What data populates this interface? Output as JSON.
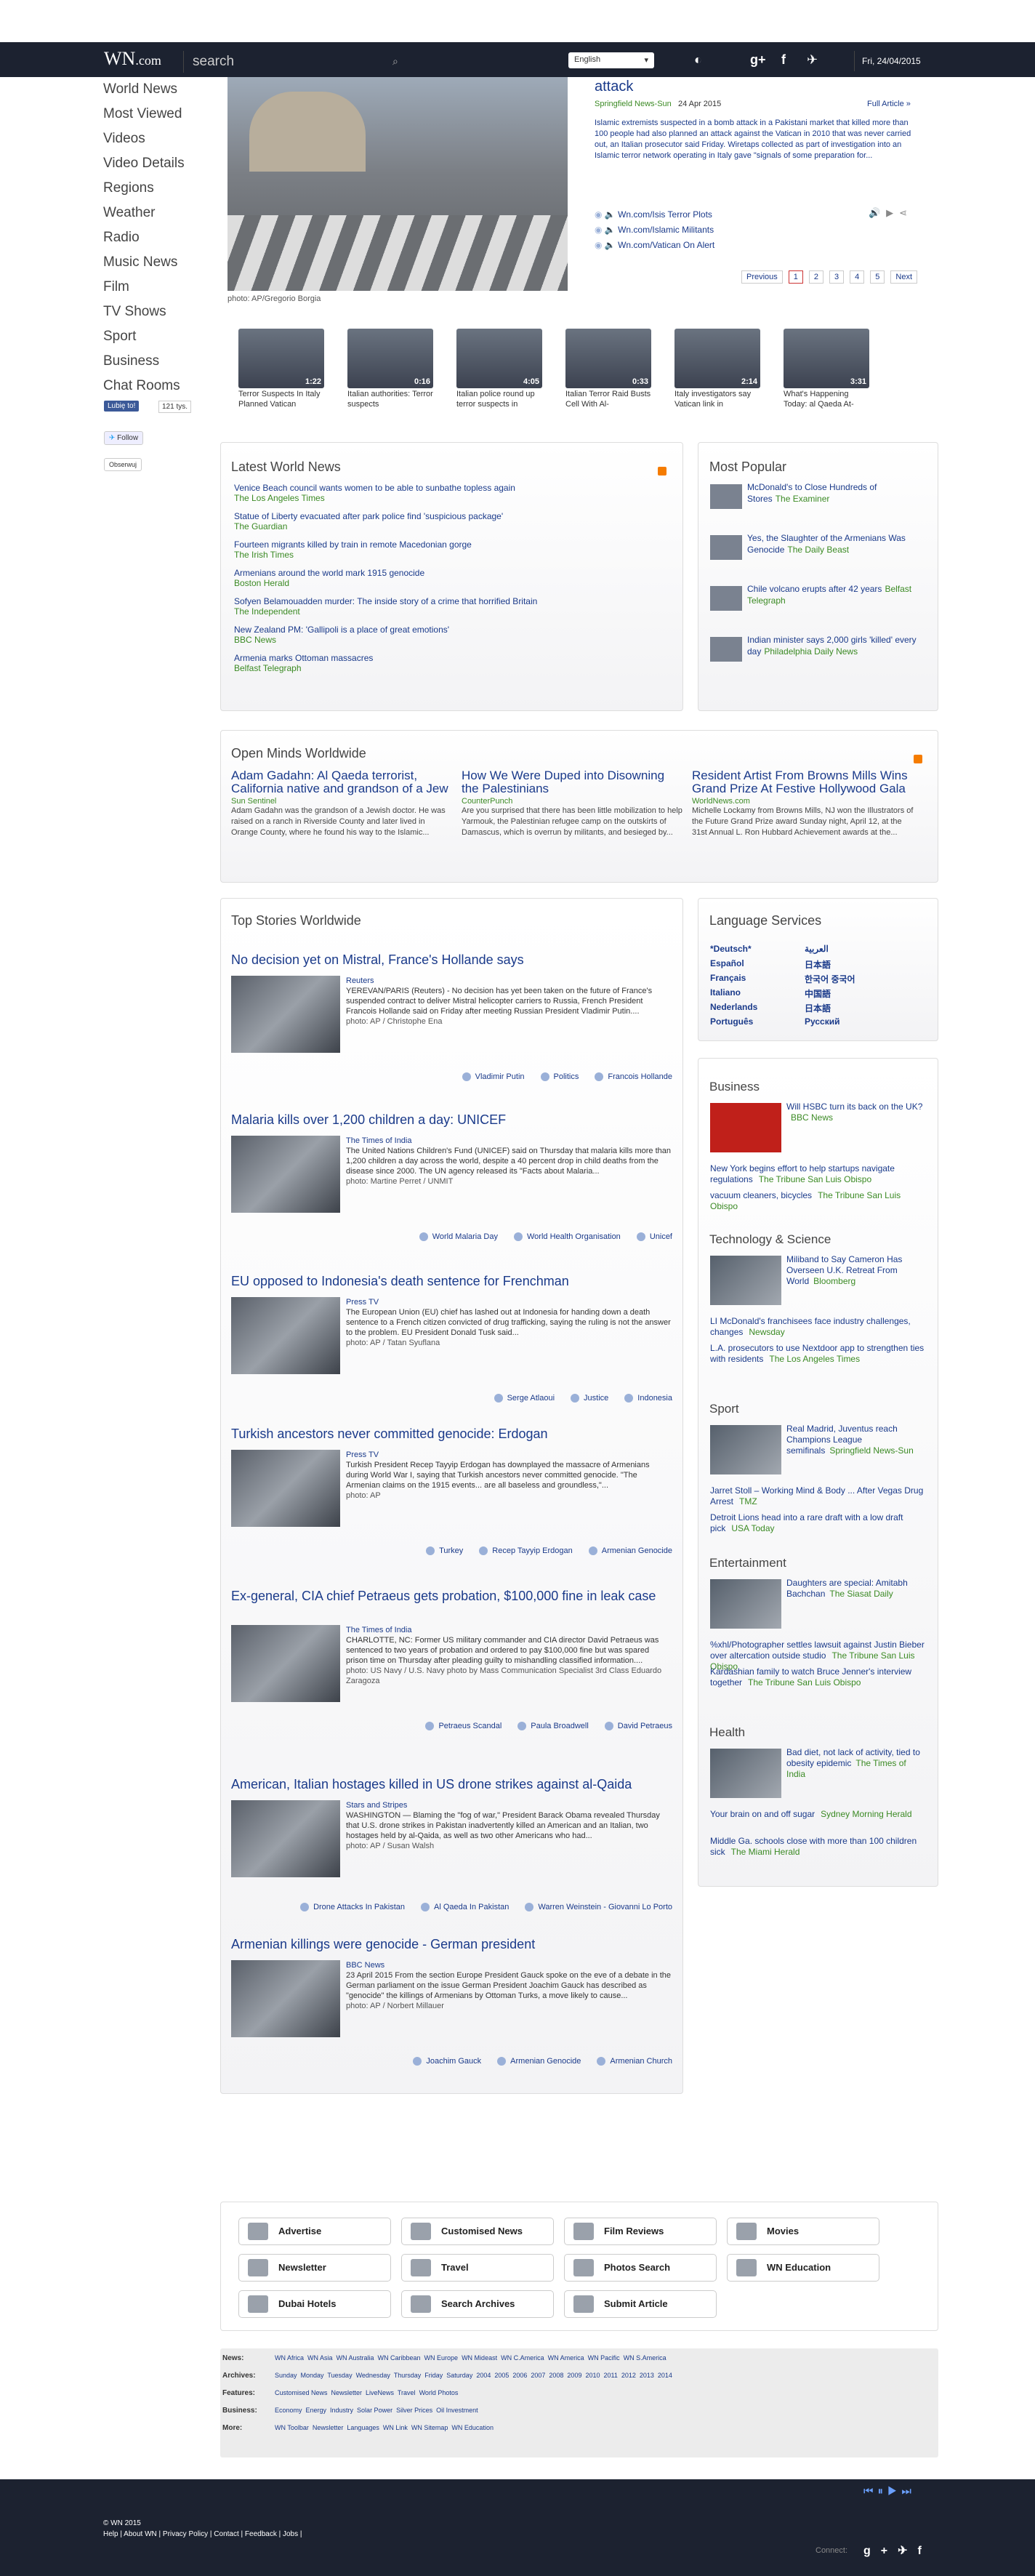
{
  "header": {
    "logo": "WN",
    "logo_suffix": ".com",
    "search_placeholder": "search",
    "language": "English",
    "date": "Fri, 24/04/2015"
  },
  "nav": [
    "World News",
    "Most Viewed",
    "Videos",
    "Video Details",
    "Regions",
    "Weather",
    "Radio",
    "Music News",
    "Film",
    "TV Shows",
    "Sport",
    "Business",
    "Chat Rooms"
  ],
  "social": {
    "like": "Lubię to!",
    "like_count": "121 tys.",
    "follow": "Follow",
    "observe": "Obserwuj"
  },
  "hero": {
    "title": "attack",
    "source": "Springfield News-Sun",
    "date": "24 Apr 2015",
    "full": "Full Article »",
    "text": "Islamic extremists suspected in a bomb attack in a Pakistani market that killed more than 100 people had also planned an attack against the Vatican in 2010 that was never carried out, an Italian prosecutor said Friday. Wiretaps collected as part of investigation into an Islamic terror network operating in Italy gave \"signals of some preparation for...",
    "photo": "photo: AP/Gregorio Borgia",
    "links": [
      "Wn.com/Isis Terror Plots",
      "Wn.com/Islamic Militants",
      "Wn.com/Vatican On Alert"
    ],
    "pager": [
      "Previous",
      "1",
      "2",
      "3",
      "4",
      "5",
      "Next"
    ]
  },
  "videos": [
    {
      "t": "Terror Suspects In Italy Planned Vatican",
      "d": "1:22"
    },
    {
      "t": "Italian authorities: Terror suspects",
      "d": "0:16"
    },
    {
      "t": "Italian police round up terror suspects in",
      "d": "4:05"
    },
    {
      "t": "Italian Terror Raid Busts Cell With Al-",
      "d": "0:33"
    },
    {
      "t": "Italy investigators say Vatican link in",
      "d": "2:14"
    },
    {
      "t": "What's Happening Today: al Qaeda At-",
      "d": "3:31"
    }
  ],
  "latest": {
    "title": "Latest World News",
    "items": [
      [
        "Venice Beach council wants women to be able to sunbathe topless again",
        "The Los Angeles Times"
      ],
      [
        "Statue of Liberty evacuated after park police find 'suspicious package'",
        "The Guardian"
      ],
      [
        "Fourteen migrants killed by train in remote Macedonian gorge",
        "The Irish Times"
      ],
      [
        "Armenians around the world mark 1915 genocide",
        "Boston Herald"
      ],
      [
        "Sofyen Belamouadden murder: The inside story of a crime that horrified Britain",
        "The Independent"
      ],
      [
        "New Zealand PM: 'Gallipoli is a place of great emotions'",
        "BBC News"
      ],
      [
        "Armenia marks Ottoman massacres",
        "Belfast Telegraph"
      ]
    ]
  },
  "popular": {
    "title": "Most Popular",
    "items": [
      [
        "McDonald's to Close Hundreds of Stores",
        "The Examiner"
      ],
      [
        "Yes, the Slaughter of the Armenians Was Genocide",
        "The Daily Beast"
      ],
      [
        "Chile volcano erupts after 42 years",
        "Belfast Telegraph"
      ],
      [
        "Indian minister says 2,000 girls 'killed' every day",
        "Philadelphia Daily News"
      ]
    ]
  },
  "opinion": {
    "title": "Open Minds Worldwide",
    "items": [
      {
        "h": "Adam Gadahn: Al Qaeda terrorist, California native and grandson of a Jew",
        "s": "Sun Sentinel",
        "t": "Adam Gadahn was the grandson of a Jewish doctor. He was raised on a ranch in Riverside County and later lived in Orange County, where he found his way to the Islamic..."
      },
      {
        "h": "How We Were Duped into Disowning the Palestinians",
        "s": "CounterPunch",
        "t": "Are you surprised that there has been little mobilization to help Yarmouk, the Palestinian refugee camp on the outskirts of Damascus, which is overrun by militants, and besieged by..."
      },
      {
        "h": "Resident Artist From Browns Mills Wins Grand Prize At Festive Hollywood Gala",
        "s": "WorldNews.com",
        "t": "Michelle Lockamy from Browns Mills, NJ won the Illustrators of the Future Grand Prize award Sunday night, April 12, at the 31st Annual L. Ron Hubbard Achievement awards at the..."
      }
    ]
  },
  "top": {
    "title": "Top Stories Worldwide",
    "stories": [
      {
        "h": "No decision yet on Mistral, France's Hollande says",
        "s": "Reuters",
        "t": "YEREVAN/PARIS (Reuters) - No decision has yet been taken on the future of France's suspended contract to deliver Mistral helicopter carriers to Russia, French President Francois Hollande said on Friday after meeting Russian President Vladimir Putin....",
        "p": "photo: AP / Christophe Ena",
        "tags": [
          "Vladimir Putin",
          "Politics",
          "Francois Hollande"
        ]
      },
      {
        "h": "Malaria kills over 1,200 children a day: UNICEF",
        "s": "The Times of India",
        "t": "The United Nations Children's Fund (UNICEF) said on Thursday that malaria kills more than 1,200 children a day across the world, despite a 40 percent drop in child deaths from the disease since 2000. The UN agency released its \"Facts about Malaria...",
        "p": "photo: Martine Perret / UNMIT",
        "tags": [
          "World Malaria Day",
          "World Health Organisation",
          "Unicef"
        ]
      },
      {
        "h": "EU opposed to Indonesia's death sentence for Frenchman",
        "s": "Press TV",
        "t": "The European Union (EU) chief has lashed out at Indonesia for handing down a death sentence to a French citizen convicted of drug trafficking, saying the ruling is not the answer to the problem. EU President Donald Tusk said...",
        "p": "photo: AP / Tatan Syuflana",
        "tags": [
          "Serge Atlaoui",
          "Justice",
          "Indonesia"
        ]
      },
      {
        "h": "Turkish ancestors never committed genocide: Erdogan",
        "s": "Press TV",
        "t": "Turkish President Recep Tayyip Erdogan has downplayed the massacre of Armenians during World War I, saying that Turkish ancestors never committed genocide. \"The Armenian claims on the 1915 events... are all baseless and groundless,\"...",
        "p": "photo: AP",
        "tags": [
          "Turkey",
          "Recep Tayyip Erdogan",
          "Armenian Genocide"
        ]
      },
      {
        "h": "Ex-general, CIA chief Petraeus gets probation, $100,000 fine in leak case",
        "s": "The Times of India",
        "t": "CHARLOTTE, NC: Former US military commander and CIA director David Petraeus was sentenced to two years of probation and ordered to pay $100,000 fine but was spared prison time on Thursday after pleading guilty to mishandling classified information....",
        "p": "photo: US Navy / U.S. Navy photo by Mass Communication Specialist 3rd Class Eduardo Zaragoza",
        "tags": [
          "Petraeus Scandal",
          "Paula Broadwell",
          "David Petraeus"
        ]
      },
      {
        "h": "American, Italian hostages killed in US drone strikes against al-Qaida",
        "s": "Stars and Stripes",
        "t": "WASHINGTON — Blaming the \"fog of war,\" President Barack Obama revealed Thursday that U.S. drone strikes in Pakistan inadvertently killed an American and an Italian, two hostages held by al-Qaida, as well as two other Americans who had...",
        "p": "photo: AP / Susan Walsh",
        "tags": [
          "Drone Attacks In Pakistan",
          "Al Qaeda In Pakistan",
          "Warren Weinstein - Giovanni Lo Porto"
        ]
      },
      {
        "h": "Armenian killings were genocide - German president",
        "s": "BBC News",
        "t": "23 April 2015 From the section Europe President Gauck spoke on the eve of a debate in the German parliament on the issue German President Joachim Gauck has described as \"genocide\" the killings of Armenians by Ottoman Turks, a move likely to cause...",
        "p": "photo: AP / Norbert Millauer",
        "tags": [
          "Joachim Gauck",
          "Armenian Genocide",
          "Armenian Church"
        ]
      }
    ]
  },
  "languages": {
    "title": "Language Services",
    "left": [
      "*Deutsch*",
      "Español",
      "Français",
      "Italiano",
      "Nederlands",
      "Português"
    ],
    "right": [
      "العربية",
      "日本語",
      "한국어 중국어",
      "中国語",
      "日本語",
      "Русский"
    ]
  },
  "business": {
    "title": "Business",
    "lead": "Will HSBC turn its back on the UK?",
    "lead_src": "BBC News",
    "items": [
      [
        "New York begins effort to help startups navigate regulations",
        "The Tribune San Luis Obispo"
      ],
      [
        "vacuum cleaners, bicycles",
        "The Tribune San Luis Obispo"
      ]
    ]
  },
  "tech": {
    "title": "Technology & Science",
    "lead": "Miliband to Say Cameron Has Overseen U.K. Retreat From World",
    "lead_src": "Bloomberg",
    "items": [
      [
        "LI McDonald's franchisees face industry challenges, changes",
        "Newsday"
      ],
      [
        "L.A. prosecutors to use Nextdoor app to strengthen ties with residents",
        "The Los Angeles Times"
      ]
    ]
  },
  "sport": {
    "title": "Sport",
    "lead": "Real Madrid, Juventus reach Champions League semifinals",
    "lead_src": "Springfield News-Sun",
    "items": [
      [
        "Jarret Stoll – Working Mind & Body ... After Vegas Drug Arrest",
        "TMZ"
      ],
      [
        "Detroit Lions head into a rare draft with a low draft pick",
        "USA Today"
      ]
    ]
  },
  "ent": {
    "title": "Entertainment",
    "lead": "Daughters are special: Amitabh Bachchan",
    "lead_src": "The Siasat Daily",
    "items": [
      [
        "%xhl/Photographer settles lawsuit against Justin Bieber over altercation outside studio",
        "The Tribune San Luis Obispo"
      ],
      [
        "Kardashian family to watch Bruce Jenner's interview together",
        "The Tribune San Luis Obispo"
      ]
    ]
  },
  "health": {
    "title": "Health",
    "lead": "Bad diet, not lack of activity, tied to obesity epidemic",
    "lead_src": "The Times of India",
    "items": [
      [
        "Your brain on and off sugar",
        "Sydney Morning Herald"
      ],
      [
        "Middle Ga. schools close with more than 100 children sick",
        "The Miami Herald"
      ]
    ]
  },
  "buttons": [
    "Advertise",
    "Customised News",
    "Film Reviews",
    "Movies",
    "Newsletter",
    "Travel",
    "Photos Search",
    "WN Education",
    "Dubai Hotels",
    "Search Archives",
    "Submit Article"
  ],
  "directory": [
    [
      "News:",
      "WN Africa  WN Asia  WN Australia  WN Caribbean  WN Europe  WN Mideast  WN C.America  WN America  WN Pacific  WN S.America"
    ],
    [
      "Archives:",
      "Sunday  Monday  Tuesday  Wednesday  Thursday  Friday  Saturday  2004  2005  2006  2007  2008  2009  2010  2011  2012  2013  2014"
    ],
    [
      "Features:",
      "Customised News  Newsletter  LiveNews  Travel  World Photos"
    ],
    [
      "Business:",
      "Economy  Energy  Industry  Solar Power  Silver Prices  Oil Investment"
    ],
    [
      "More:",
      "WN Toolbar  Newsletter  Languages  WN Link  WN Sitemap  WN Education"
    ]
  ],
  "footer": {
    "copy": "© WN 2015",
    "links": "Help | About WN | Privacy Policy | Contact | Feedback | Jobs |",
    "connect": "Connect:"
  }
}
